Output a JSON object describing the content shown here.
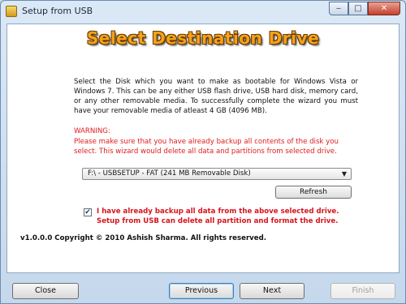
{
  "window": {
    "title": "Setup from USB",
    "icon": "setup-app-icon"
  },
  "caption": {
    "minimize": "‒",
    "maximize": "□",
    "close": "✕"
  },
  "heading": "Select Destination Drive",
  "description": "Select the Disk which you want to make as bootable for Windows Vista or Windows 7. This can be any either USB flash drive, USB hard disk, memory card, or any other removable media. To successfully complete the wizard you must have your removable media of atleast 4 GB (4096 MB).",
  "warning": {
    "title": "WARNING:",
    "text": "Please make sure that you have already backup all contents of the disk you select. This wizard would delete all data and partitions from selected drive."
  },
  "drive": {
    "selected": "F:\\ - USBSETUP - FAT (241 MB Removable Disk)"
  },
  "refresh_label": "Refresh",
  "confirm": {
    "checked": true,
    "label": "I have already backup all data from the above selected drive. Setup from USB can delete all partition and format the drive."
  },
  "copyright": "v1.0.0.0 Copyright © 2010 Ashish Sharma. All rights reserved.",
  "buttons": {
    "close": "Close",
    "previous": "Previous",
    "next": "Next",
    "finish": "Finish"
  },
  "colors": {
    "heading": "#f3a21b",
    "warning": "#e01b1b",
    "confirm": "#d8131c"
  }
}
